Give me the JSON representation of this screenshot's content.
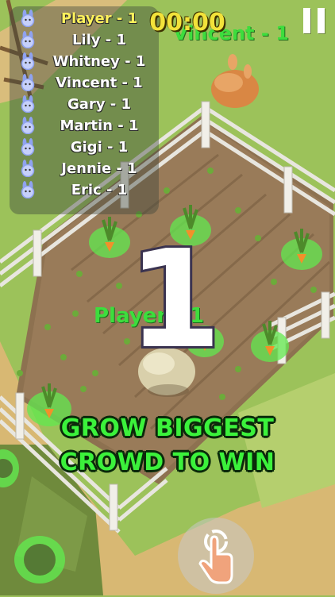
{
  "hud": {
    "timer": "00:00",
    "pause_icon": "pause-icon"
  },
  "leaderboard": {
    "icon": "bunny-icon",
    "entries": [
      {
        "name": "Player - 1",
        "is_player": true
      },
      {
        "name": "Lily - 1",
        "is_player": false
      },
      {
        "name": "Whitney - 1",
        "is_player": false
      },
      {
        "name": "Vincent - 1",
        "is_player": false
      },
      {
        "name": "Gary - 1",
        "is_player": false
      },
      {
        "name": "Martin - 1",
        "is_player": false
      },
      {
        "name": "Gigi - 1",
        "is_player": false
      },
      {
        "name": "Jennie - 1",
        "is_player": false
      },
      {
        "name": "Eric - 1",
        "is_player": false
      }
    ]
  },
  "world": {
    "vincent_label": "Vincent - 1",
    "player_label": "Player - 1"
  },
  "countdown": "1",
  "banner": {
    "line1": "GROW BIGGEST",
    "line2": "CROWD TO WIN"
  },
  "controls": {
    "tap_icon": "tap-hand-icon"
  },
  "colors": {
    "leaderboard_player": "#fff25c",
    "timer": "#f2e23a",
    "banner_text": "#3bf23b",
    "label_green": "#3ddd3d"
  }
}
